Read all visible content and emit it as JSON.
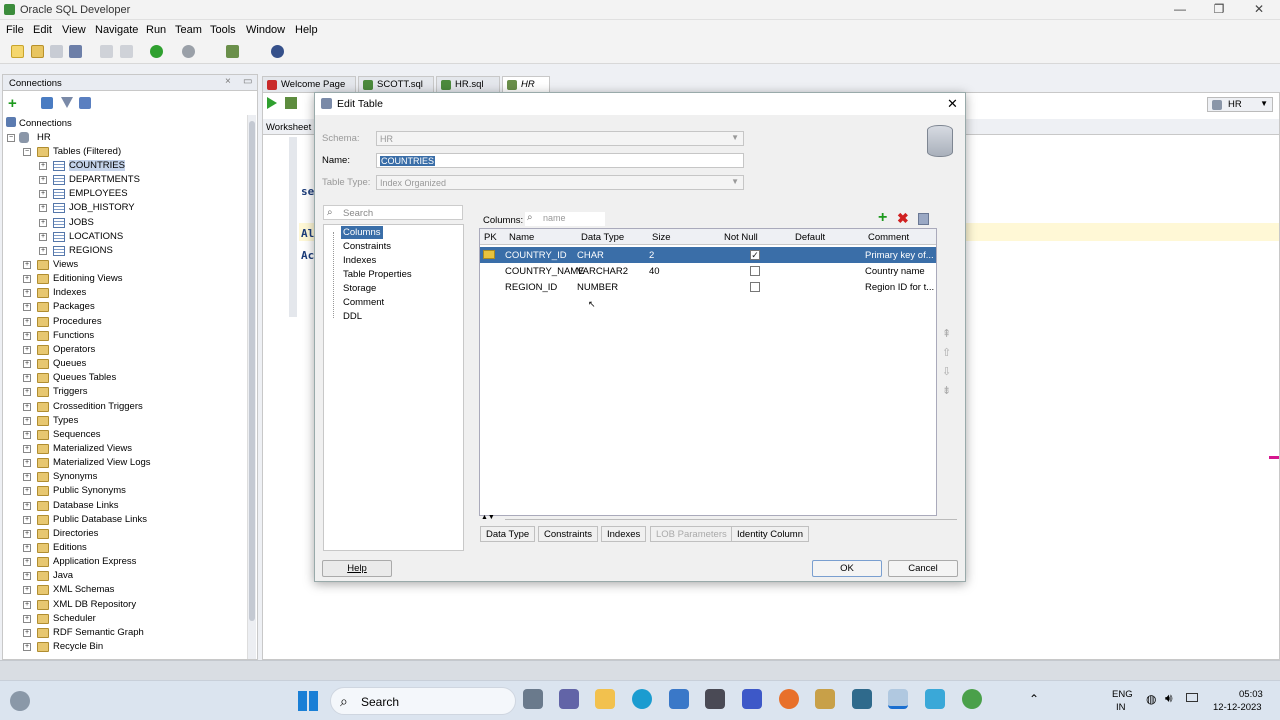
{
  "app": {
    "title": "Oracle SQL Developer",
    "minimize": "—",
    "maximize": "❐",
    "close": "✕"
  },
  "menu": [
    "File",
    "Edit",
    "View",
    "Navigate",
    "Run",
    "Team",
    "Tools",
    "Window",
    "Help"
  ],
  "connections": {
    "panel_title": "Connections",
    "root": "Connections",
    "hr": "HR",
    "tables_folder": "Tables (Filtered)",
    "tables": [
      "COUNTRIES",
      "DEPARTMENTS",
      "EMPLOYEES",
      "JOB_HISTORY",
      "JOBS",
      "LOCATIONS",
      "REGIONS"
    ],
    "folders": [
      "Views",
      "Editioning Views",
      "Indexes",
      "Packages",
      "Procedures",
      "Functions",
      "Operators",
      "Queues",
      "Queues Tables",
      "Triggers",
      "Crossedition Triggers",
      "Types",
      "Sequences",
      "Materialized Views",
      "Materialized View Logs",
      "Synonyms",
      "Public Synonyms",
      "Database Links",
      "Public Database Links",
      "Directories",
      "Editions",
      "Application Express",
      "Java",
      "XML Schemas",
      "XML DB Repository",
      "Scheduler",
      "RDF Semantic Graph",
      "Recycle Bin"
    ]
  },
  "tabs": [
    "Welcome Page",
    "SCOTT.sql",
    "HR.sql",
    "HR"
  ],
  "editor": {
    "worksheet_tab": "Worksheet",
    "connection": "HR",
    "snippets": [
      "se",
      "Al",
      "Ac"
    ]
  },
  "dialog": {
    "title": "Edit Table",
    "schema_label": "Schema:",
    "schema_value": "HR",
    "name_label": "Name:",
    "name_value": "COUNTRIES",
    "table_type_label": "Table Type:",
    "table_type_value": "Index Organized",
    "search_placeholder": "Search",
    "nav": [
      "Columns",
      "Constraints",
      "Indexes",
      "Table Properties",
      "Storage",
      "Comment",
      "DDL"
    ],
    "columns_label": "Columns:",
    "columns_filter_placeholder": "name",
    "headers": [
      "PK",
      "Name",
      "Data Type",
      "Size",
      "Not Null",
      "Default",
      "Comment"
    ],
    "rows": [
      {
        "name": "COUNTRY_ID",
        "type": "CHAR",
        "size": "2",
        "not_null": "✓",
        "default": "",
        "comment": "Primary key of..."
      },
      {
        "name": "COUNTRY_NAME",
        "type": "VARCHAR2",
        "size": "40",
        "not_null": "",
        "default": "",
        "comment": "Country name"
      },
      {
        "name": "REGION_ID",
        "type": "NUMBER",
        "size": "",
        "not_null": "",
        "default": "",
        "comment": "Region ID for t..."
      }
    ],
    "bottom_tabs": [
      "Data Type",
      "Constraints",
      "Indexes",
      "LOB Parameters",
      "Identity Column"
    ],
    "help": "Help",
    "ok": "OK",
    "cancel": "Cancel"
  },
  "taskbar": {
    "search": "Search",
    "lang1": "ENG",
    "lang2": "IN",
    "time": "05:03",
    "date": "12-12-2023"
  }
}
